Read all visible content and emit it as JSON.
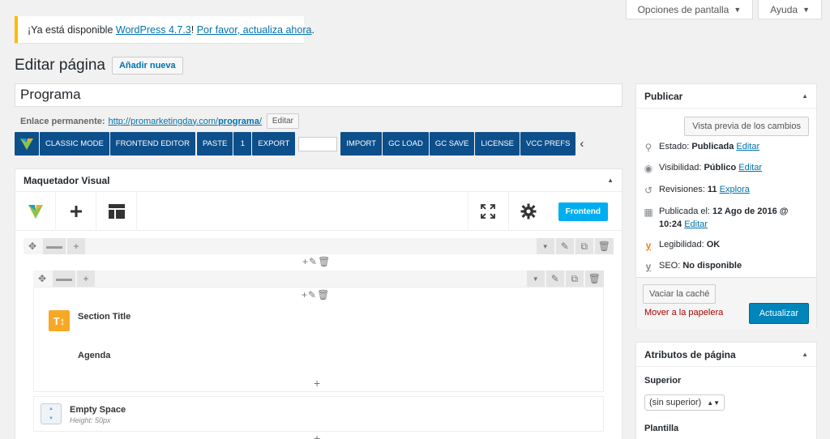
{
  "screen_meta": {
    "options_label": "Opciones de pantalla",
    "help_label": "Ayuda",
    "arrow": "▼"
  },
  "notice": {
    "prefix": "¡Ya está disponible ",
    "link1": "WordPress 4.7.3",
    "middle": "! ",
    "link2": "Por favor, actualiza ahora",
    "suffix": "."
  },
  "header": {
    "title": "Editar página",
    "add_new_label": "Añadir nueva"
  },
  "post_title": "Programa",
  "permalink": {
    "label": "Enlace permanente:",
    "url_prefix": "http://promarketingday.com/",
    "url_slug": "programa",
    "url_suffix": "/",
    "edit_label": "Editar"
  },
  "vc_toolbar": {
    "classic_mode": "CLASSIC MODE",
    "frontend_editor": "FRONTEND EDITOR",
    "paste": "PASTE",
    "paste_count": "1",
    "export": "EXPORT",
    "import": "IMPORT",
    "gc_load": "GC LOAD",
    "gc_save": "GC SAVE",
    "license": "LICENSE",
    "vcc_prefs": "VCC PREFS",
    "chevron": "‹"
  },
  "visual_composer": {
    "title": "Maquetador Visual",
    "frontend_label": "Frontend",
    "elements": [
      {
        "title": "Section Title",
        "icon_text": "T↕"
      },
      {
        "title": "Agenda"
      }
    ],
    "empty_space": {
      "title": "Empty Space",
      "subtitle": "Height: 50px"
    }
  },
  "publish": {
    "title": "Publicar",
    "preview_label": "Vista previa de los cambios",
    "status_label": "Estado: ",
    "status_value": "Publicada",
    "visibility_label": "Visibilidad: ",
    "visibility_value": "Público",
    "revisions_label": "Revisiones: ",
    "revisions_value": "11",
    "revisions_link": "Explora",
    "published_label": "Publicada el: ",
    "published_value_1": "12 Ago de 2016 @",
    "published_value_2": "10:24",
    "edit_link": "Editar",
    "readability_label": "Legibilidad: ",
    "readability_value": "OK",
    "seo_label": "SEO: ",
    "seo_value": "No disponible",
    "flush_cache_label": "Vaciar la caché",
    "trash_label": "Mover a la papelera",
    "update_label": "Actualizar"
  },
  "page_attributes": {
    "title": "Atributos de página",
    "parent_label": "Superior",
    "parent_value": "(sin superior)",
    "template_label": "Plantilla"
  }
}
